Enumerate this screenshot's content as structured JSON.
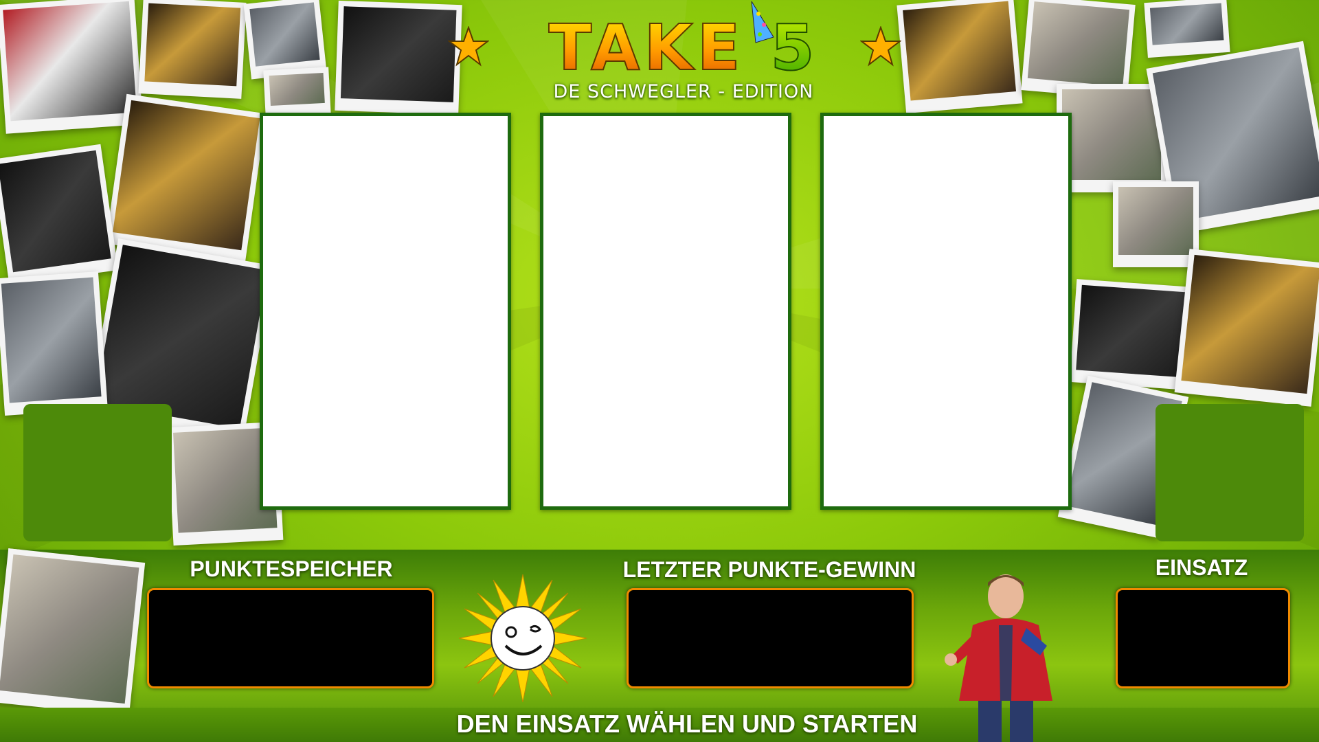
{
  "title": {
    "main": "TAKE",
    "number": "5",
    "subtitle": "DE SCHWEGLER - EDITION"
  },
  "reels": [
    {
      "name": "reel-1",
      "symbol": ""
    },
    {
      "name": "reel-2",
      "symbol": ""
    },
    {
      "name": "reel-3",
      "symbol": ""
    }
  ],
  "panels": {
    "points_storage": {
      "label": "PUNKTESPEICHER",
      "value": ""
    },
    "last_win": {
      "label": "LETZTER PUNKTE-GEWINN",
      "value": ""
    },
    "stake": {
      "label": "EINSATZ",
      "value": ""
    }
  },
  "footer": {
    "instruction": "DEN EINSATZ WÄHLEN UND STARTEN"
  },
  "colors": {
    "background": "#8cc90a",
    "reel_border": "#1e6b0e",
    "display_border": "#f08a00",
    "side_panel": "#4d8a0a"
  },
  "icons": [
    "star-icon",
    "party-hat-icon",
    "sun-mascot-icon"
  ]
}
